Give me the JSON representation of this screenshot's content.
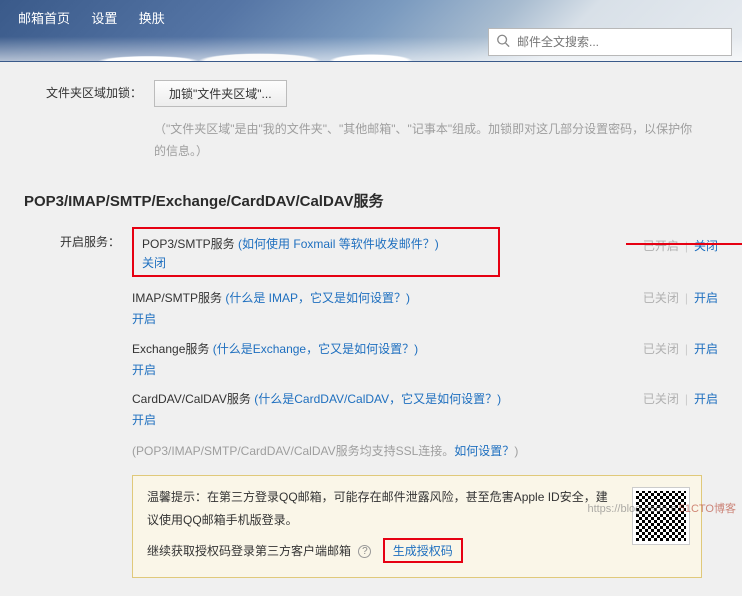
{
  "nav": {
    "home": "邮箱首页",
    "settings": "设置",
    "skin": "换肤"
  },
  "search": {
    "placeholder": "邮件全文搜索..."
  },
  "folder_lock": {
    "label": "文件夹区域加锁：",
    "button": "加锁\"文件夹区域\"...",
    "desc": "（\"文件夹区域\"是由\"我的文件夹\"、\"其他邮箱\"、\"记事本\"组成。加锁即对这几部分设置密码，以保护你的信息。）"
  },
  "section_title": "POP3/IMAP/SMTP/Exchange/CardDAV/CalDAV服务",
  "enable_label": "开启服务：",
  "services": {
    "pop3": {
      "name": "POP3/SMTP服务 ",
      "help": "(如何使用 Foxmail 等软件收发邮件？)",
      "action": "关闭",
      "status": "已开启",
      "toggle": "关闭"
    },
    "imap": {
      "name": "IMAP/SMTP服务 ",
      "help": "(什么是 IMAP，它又是如何设置？)",
      "action": "开启",
      "status": "已关闭",
      "toggle": "开启"
    },
    "exchange": {
      "name": "Exchange服务 ",
      "help": "(什么是Exchange，它又是如何设置？)",
      "action": "开启",
      "status": "已关闭",
      "toggle": "开启"
    },
    "carddav": {
      "name": "CardDAV/CalDAV服务 ",
      "help": "(什么是CardDAV/CalDAV，它又是如何设置？)",
      "action": "开启",
      "status": "已关闭",
      "toggle": "开启"
    }
  },
  "ssl_note": {
    "text": "(POP3/IMAP/SMTP/CardDAV/CalDAV服务均支持SSL连接。",
    "link": "如何设置？",
    "tail": ")"
  },
  "warm": {
    "label": "温馨提示：",
    "line1": "在第三方登录QQ邮箱，可能存在邮件泄露风险，甚至危害Apple ID安全，建议使用QQ邮箱手机版登录。",
    "line2": "继续获取授权码登录第三方客户端邮箱",
    "gen": "生成授权码"
  },
  "watermark": {
    "url": "https://blog.csdn.n",
    "brand": "51CTO博客"
  }
}
